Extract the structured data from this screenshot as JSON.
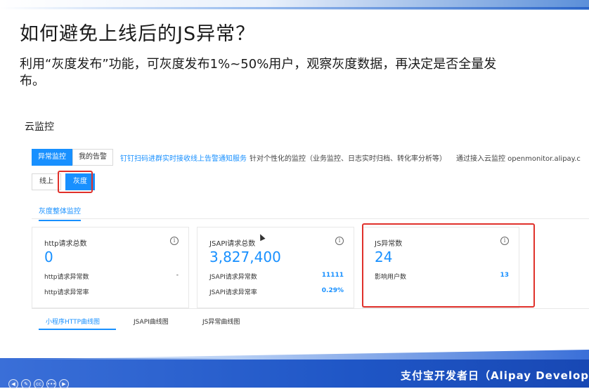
{
  "slide": {
    "title": "如何避免上线后的JS异常？",
    "description": "利用“灰度发布”功能，可灰度发布1%~50%用户，观察灰度数据，再决定是否全量发布。",
    "section_label": "云监控"
  },
  "nav": {
    "tabs": [
      "异常监控",
      "我的告警"
    ],
    "active_tab": 0,
    "link": "钉钉扫码进群实时接收线上告警通知服务",
    "text1": "针对个性化的监控（业务监控、日志实时归档、转化率分析等）",
    "text2": "通过接入云监控 openmonitor.alipay.c"
  },
  "env": {
    "options": [
      "线上",
      "灰度"
    ],
    "active": 1
  },
  "overview_tab": "灰度整体监控",
  "cards": [
    {
      "title": "http请求总数",
      "value": "0",
      "rows": [
        {
          "label": "http请求异常数",
          "value": "-"
        },
        {
          "label": "http请求异常率",
          "value": ""
        }
      ]
    },
    {
      "title": "JSAPI请求总数",
      "value": "3,827,400",
      "rows": [
        {
          "label": "JSAPI请求异常数",
          "value": "11111"
        },
        {
          "label": "JSAPI请求异常率",
          "value": "0.29%"
        }
      ]
    },
    {
      "title": "JS异常数",
      "value": "24",
      "rows": [
        {
          "label": "影响用户数",
          "value": "13"
        }
      ]
    }
  ],
  "chart_tabs": [
    "小程序HTTP曲线图",
    "JSAPI曲线图",
    "JS异常曲线图"
  ],
  "footer": "支付宝开发者日（Alipay Develop",
  "controls": [
    "prev-icon",
    "pen-icon",
    "captions-icon",
    "more-icon",
    "next-icon"
  ],
  "colors": {
    "accent": "#1890ff",
    "highlight": "#e0312b",
    "band": "#1f56c6"
  }
}
